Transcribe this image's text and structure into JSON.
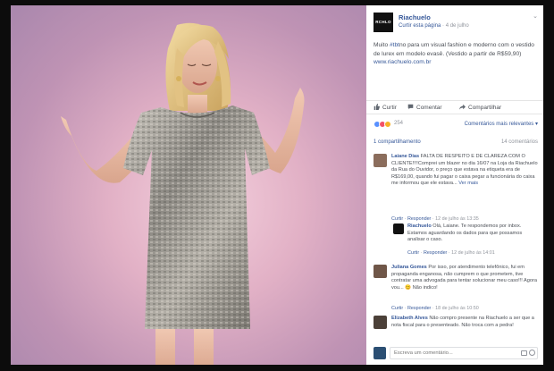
{
  "page": {
    "name": "Riachuelo",
    "logo_text": "RCHLO",
    "like_page": "Curtir esta página",
    "separator": " · ",
    "date": "4 de julho",
    "chevron": "⌄"
  },
  "post": {
    "text_pre": "Muito ",
    "hashtag": "#tbt",
    "text_mid": "no para um visual fashion e moderno com o vestido de lurex em modelo evasê. (Vestido a partir de R$59,90) ",
    "url": "www.riachuelo.com.br"
  },
  "actions": {
    "like": "Curtir",
    "comment": "Comentar",
    "share": "Compartilhar"
  },
  "reactions": {
    "count": "254",
    "sort": "Comentários mais relevantes ▾"
  },
  "shares": {
    "label": "1 compartilhamento",
    "comments_count": "14 comentários"
  },
  "comments": [
    {
      "author": "Laiane Dias",
      "text": " FALTA DE RESPEITO E DE CLAREZA COM O CLIENTE!!!!Comprei um blazer no dia 16/07 na Loja da Riachuelo da Rua do Ouvidor, o preço que estava na etiqueta era de R$169,00, quando fui pagar o caixa pegar a funcionária do caixa me informou que ele estava...",
      "more": " Ver mais",
      "like": "Curtir",
      "reply": "Responder",
      "time": "12 de julho às 13:35"
    },
    {
      "author": "Riachuelo",
      "text": " Olá, Laiane. Te respondemos por inbox. Estamos aguardando os dados para que possamos analisar o caso.",
      "like": "Curtir",
      "reply": "Responder",
      "time": "12 de julho às 14:01"
    },
    {
      "author": "Juliana Gomes",
      "text": " Por isso, por atendimento telefônico, fui em propaganda enganosa, não cumprem o que prometem, tive contratar uma advogada para tentar solucionar meu caso!!! Agora vou... 😊 Não indico!",
      "like": "Curtir",
      "reply": "Responder",
      "time": "18 de julho às 10:50"
    },
    {
      "author": "Elizabeth Alves",
      "text": " Não compro presente na Riachuelo a ser que a nota fiscal para o presenteado. Não troca com a pedra!"
    }
  ],
  "composer": {
    "placeholder": "Escreva um comentário..."
  },
  "colors": {
    "link": "#365899",
    "text": "#4b4f56",
    "meta": "#90949c",
    "dress": "#9a9690",
    "background_top": "#a987ad"
  }
}
